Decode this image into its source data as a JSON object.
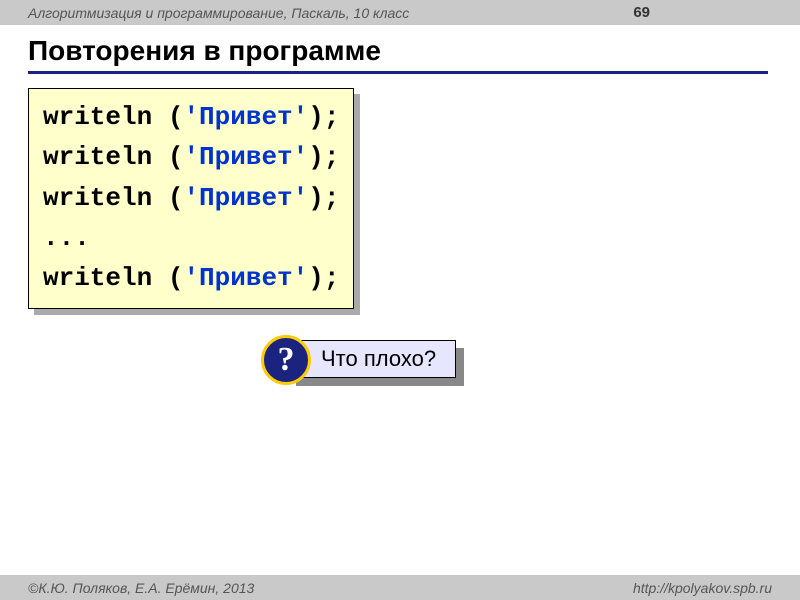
{
  "header": {
    "course": "Алгоритмизация и программирование, Паскаль, 10 класс",
    "page_number": "69"
  },
  "title": "Повторения в программе",
  "code": {
    "lines": [
      {
        "call": "writeln (",
        "string": "'Привет'",
        "tail": ");"
      },
      {
        "call": "writeln (",
        "string": "'Привет'",
        "tail": ");"
      },
      {
        "call": "writeln (",
        "string": "'Привет'",
        "tail": ");"
      },
      {
        "plain": "..."
      },
      {
        "call": "writeln (",
        "string": "'Привет'",
        "tail": ");"
      }
    ]
  },
  "question": {
    "mark": "?",
    "text": "Что плохо?"
  },
  "footer": {
    "copyright": "©К.Ю. Поляков, Е.А. Ерёмин, 2013",
    "url": "http://kpolyakov.spb.ru"
  }
}
